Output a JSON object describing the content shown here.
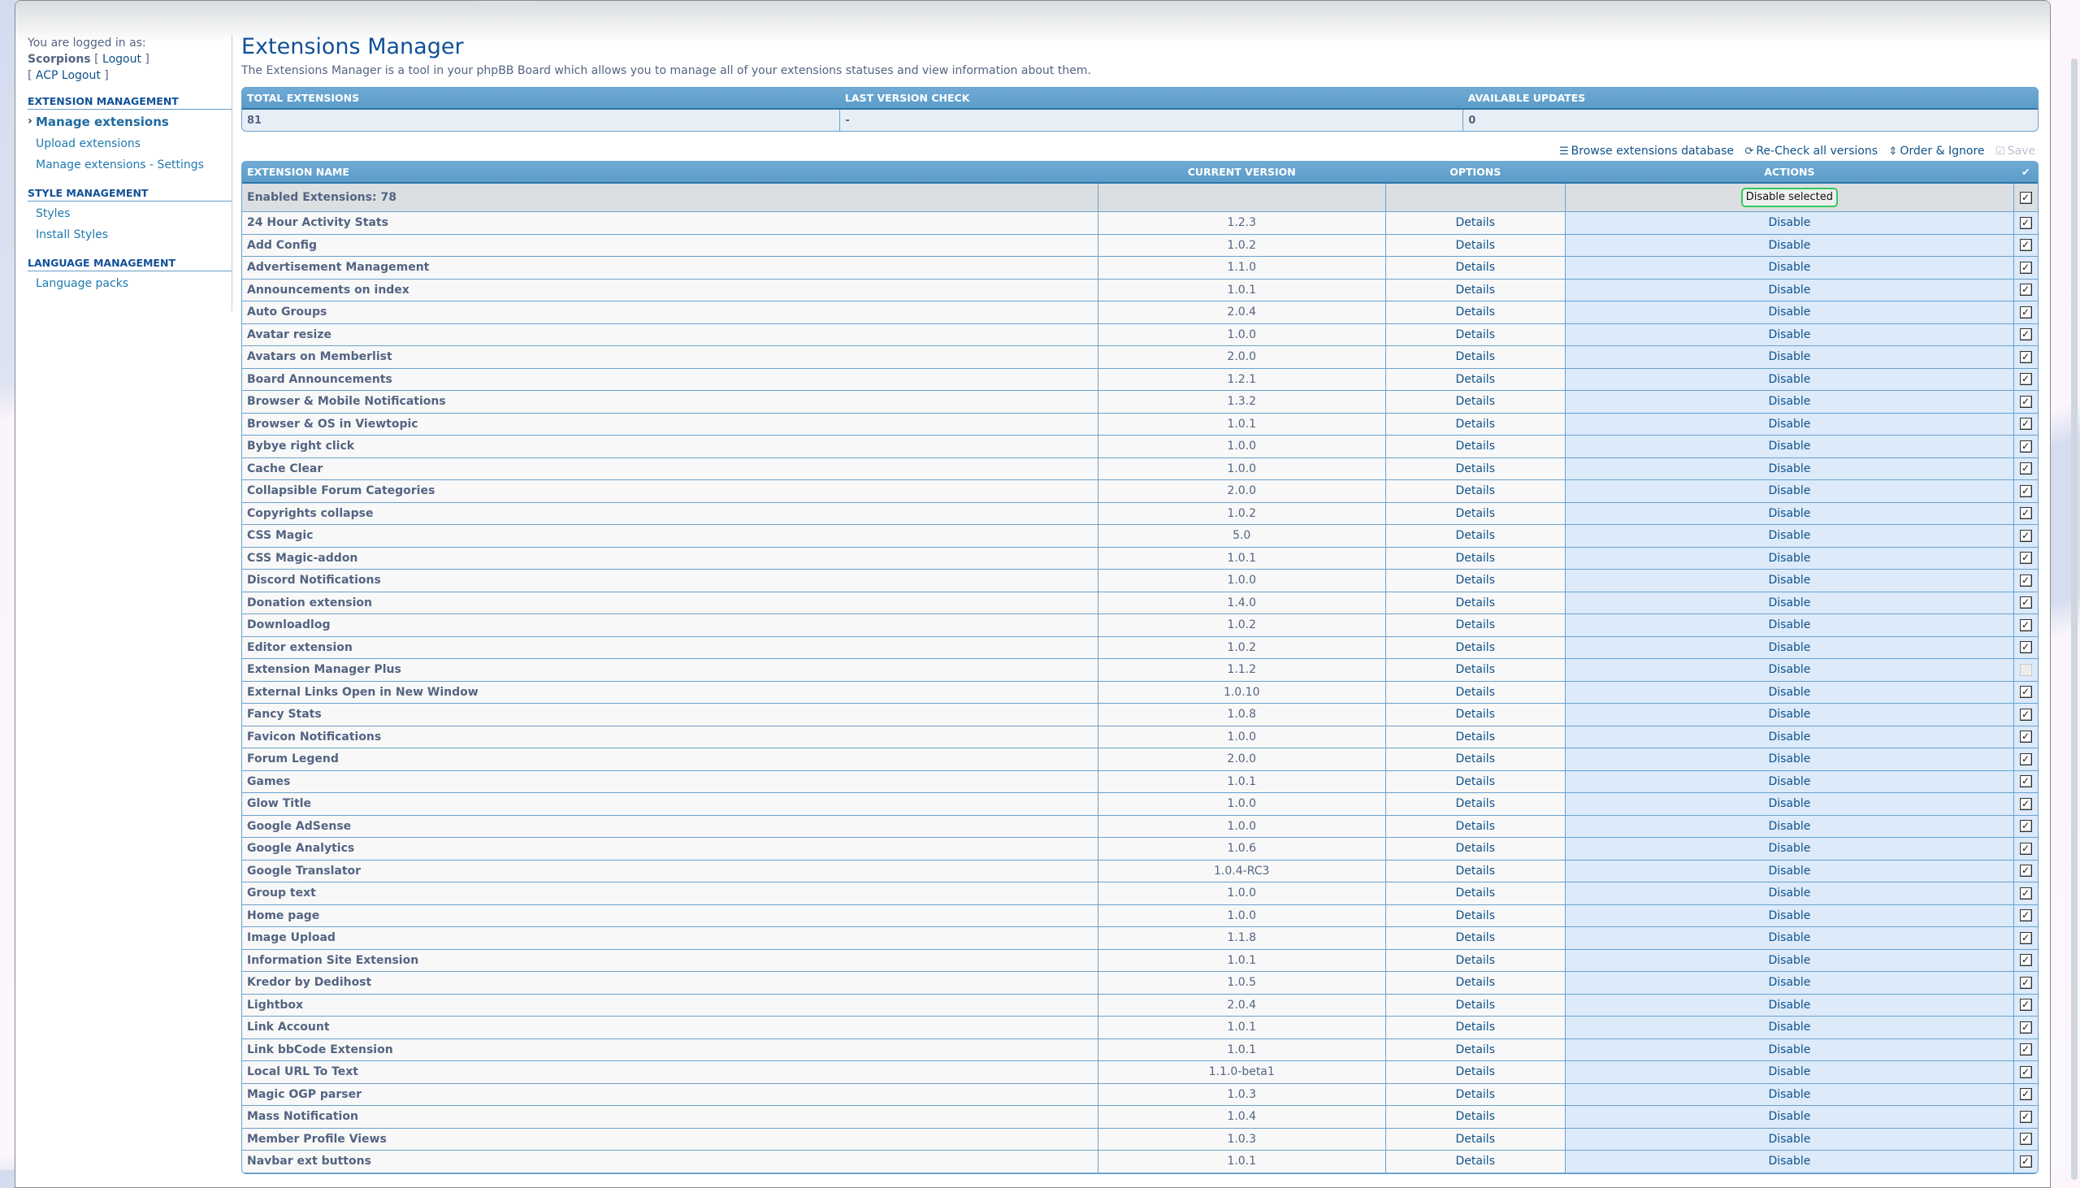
{
  "sidebar": {
    "logged_in_label": "You are logged in as:",
    "username": "Scorpions",
    "logout": "Logout",
    "acp_logout": "ACP Logout",
    "sections": [
      {
        "title": "EXTENSION MANAGEMENT",
        "items": [
          {
            "label": "Manage extensions",
            "active": true
          },
          {
            "label": "Upload extensions",
            "active": false
          },
          {
            "label": "Manage extensions - Settings",
            "active": false
          }
        ]
      },
      {
        "title": "STYLE MANAGEMENT",
        "items": [
          {
            "label": "Styles",
            "active": false
          },
          {
            "label": "Install Styles",
            "active": false
          }
        ]
      },
      {
        "title": "LANGUAGE MANAGEMENT",
        "items": [
          {
            "label": "Language packs",
            "active": false
          }
        ]
      }
    ]
  },
  "main": {
    "title": "Extensions Manager",
    "description": "The Extensions Manager is a tool in your phpBB Board which allows you to manage all of your extensions statuses and view information about them.",
    "summary": {
      "headers": [
        "TOTAL EXTENSIONS",
        "LAST VERSION CHECK",
        "AVAILABLE UPDATES"
      ],
      "values": [
        "81",
        "-",
        "0"
      ]
    },
    "toolbar": {
      "browse": "Browse extensions database",
      "recheck": "Re-Check all versions",
      "order": "Order & Ignore",
      "save": "Save"
    },
    "table": {
      "headers": {
        "name": "EXTENSION NAME",
        "version": "CURRENT VERSION",
        "options": "OPTIONS",
        "actions": "ACTIONS",
        "check": "✔"
      },
      "group_label": "Enabled Extensions: 78",
      "group_button": "Disable selected",
      "group_checked": true,
      "details_label": "Details",
      "action_label": "Disable",
      "rows": [
        {
          "name": "24 Hour Activity Stats",
          "version": "1.2.3",
          "checked": true
        },
        {
          "name": "Add Config",
          "version": "1.0.2",
          "checked": true
        },
        {
          "name": "Advertisement Management",
          "version": "1.1.0",
          "checked": true
        },
        {
          "name": "Announcements on index",
          "version": "1.0.1",
          "checked": true
        },
        {
          "name": "Auto Groups",
          "version": "2.0.4",
          "checked": true
        },
        {
          "name": "Avatar resize",
          "version": "1.0.0",
          "checked": true
        },
        {
          "name": "Avatars on Memberlist",
          "version": "2.0.0",
          "checked": true
        },
        {
          "name": "Board Announcements",
          "version": "1.2.1",
          "checked": true
        },
        {
          "name": "Browser & Mobile Notifications",
          "version": "1.3.2",
          "checked": true
        },
        {
          "name": "Browser & OS in Viewtopic",
          "version": "1.0.1",
          "checked": true
        },
        {
          "name": "Bybye right click",
          "version": "1.0.0",
          "checked": true
        },
        {
          "name": "Cache Clear",
          "version": "1.0.0",
          "checked": true
        },
        {
          "name": "Collapsible Forum Categories",
          "version": "2.0.0",
          "checked": true
        },
        {
          "name": "Copyrights collapse",
          "version": "1.0.2",
          "checked": true
        },
        {
          "name": "CSS Magic",
          "version": "5.0",
          "checked": true
        },
        {
          "name": "CSS Magic-addon",
          "version": "1.0.1",
          "checked": true
        },
        {
          "name": "Discord Notifications",
          "version": "1.0.0",
          "checked": true
        },
        {
          "name": "Donation extension",
          "version": "1.4.0",
          "checked": true
        },
        {
          "name": "Downloadlog",
          "version": "1.0.2",
          "checked": true
        },
        {
          "name": "Editor extension",
          "version": "1.0.2",
          "checked": true
        },
        {
          "name": "Extension Manager Plus",
          "version": "1.1.2",
          "checked": false
        },
        {
          "name": "External Links Open in New Window",
          "version": "1.0.10",
          "checked": true
        },
        {
          "name": "Fancy Stats",
          "version": "1.0.8",
          "checked": true
        },
        {
          "name": "Favicon Notifications",
          "version": "1.0.0",
          "checked": true
        },
        {
          "name": "Forum Legend",
          "version": "2.0.0",
          "checked": true
        },
        {
          "name": "Games",
          "version": "1.0.1",
          "checked": true
        },
        {
          "name": "Glow Title",
          "version": "1.0.0",
          "checked": true
        },
        {
          "name": "Google AdSense",
          "version": "1.0.0",
          "checked": true
        },
        {
          "name": "Google Analytics",
          "version": "1.0.6",
          "checked": true
        },
        {
          "name": "Google Translator",
          "version": "1.0.4-RC3",
          "checked": true
        },
        {
          "name": "Group text",
          "version": "1.0.0",
          "checked": true
        },
        {
          "name": "Home page",
          "version": "1.0.0",
          "checked": true
        },
        {
          "name": "Image Upload",
          "version": "1.1.8",
          "checked": true
        },
        {
          "name": "Information Site Extension",
          "version": "1.0.1",
          "checked": true
        },
        {
          "name": "Kredor by Dedihost",
          "version": "1.0.5",
          "checked": true
        },
        {
          "name": "Lightbox",
          "version": "2.0.4",
          "checked": true
        },
        {
          "name": "Link Account",
          "version": "1.0.1",
          "checked": true
        },
        {
          "name": "Link bbCode Extension",
          "version": "1.0.1",
          "checked": true
        },
        {
          "name": "Local URL To Text",
          "version": "1.1.0-beta1",
          "checked": true
        },
        {
          "name": "Magic OGP parser",
          "version": "1.0.3",
          "checked": true
        },
        {
          "name": "Mass Notification",
          "version": "1.0.4",
          "checked": true
        },
        {
          "name": "Member Profile Views",
          "version": "1.0.3",
          "checked": true
        },
        {
          "name": "Navbar ext buttons",
          "version": "1.0.1",
          "checked": true
        }
      ]
    }
  },
  "colors": {
    "header_blue": "#5b9cc9",
    "title_blue": "#115098",
    "link_blue": "#105289",
    "action_cell_bg": "#dceafa",
    "button_border_green": "#36c95a"
  }
}
